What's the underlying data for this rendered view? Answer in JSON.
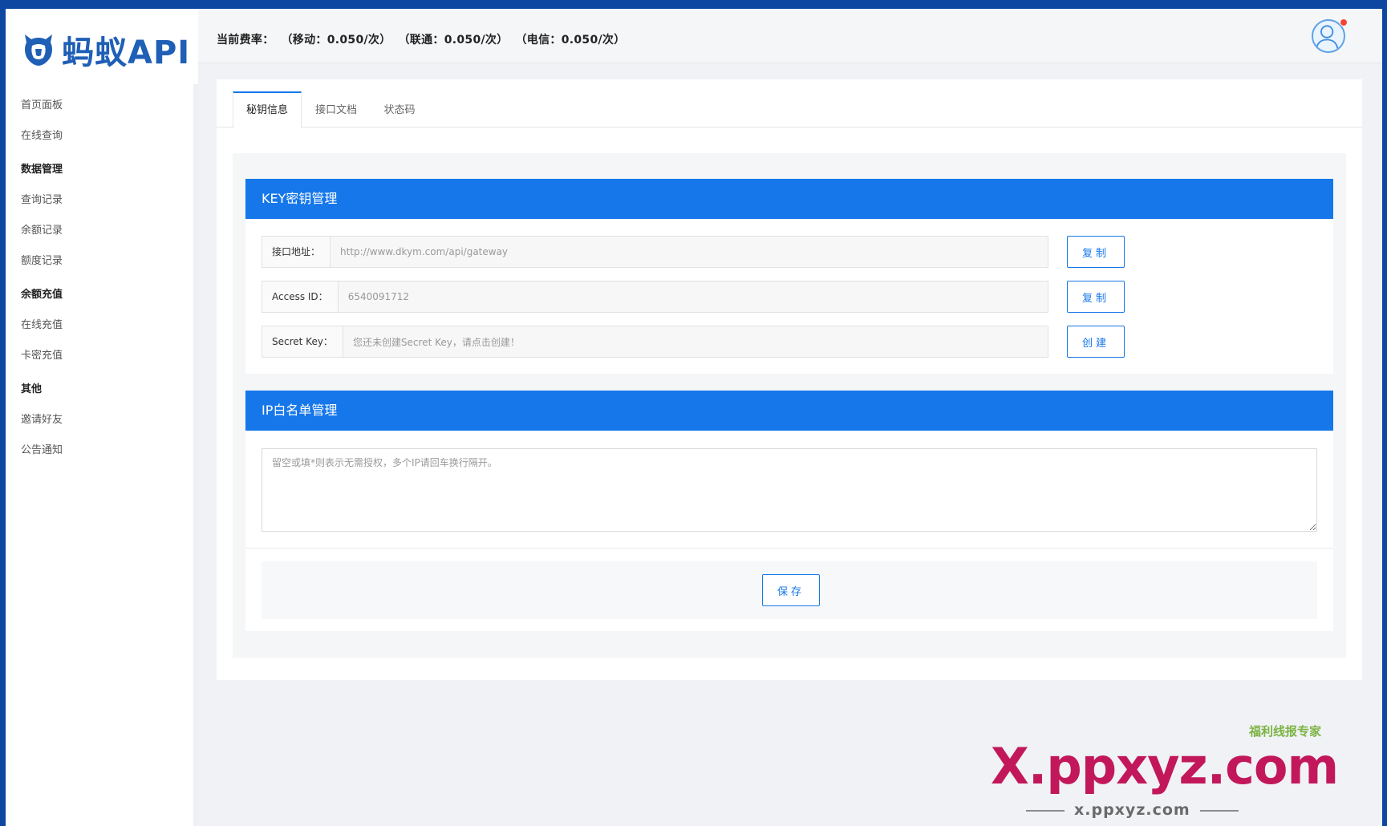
{
  "brand": {
    "name": "蚂蚁API",
    "color": "#1f5fb6"
  },
  "sidebar": {
    "items": [
      {
        "type": "item",
        "label": "首页面板"
      },
      {
        "type": "item",
        "label": "在线查询"
      },
      {
        "type": "group",
        "label": "数据管理"
      },
      {
        "type": "item",
        "label": "查询记录"
      },
      {
        "type": "item",
        "label": "余额记录"
      },
      {
        "type": "item",
        "label": "额度记录"
      },
      {
        "type": "group",
        "label": "余额充值"
      },
      {
        "type": "item",
        "label": "在线充值"
      },
      {
        "type": "item",
        "label": "卡密充值"
      },
      {
        "type": "group",
        "label": "其他"
      },
      {
        "type": "item",
        "label": "邀请好友"
      },
      {
        "type": "item",
        "label": "公告通知"
      }
    ]
  },
  "header": {
    "rate_label": "当前费率：",
    "rates": [
      "（移动：0.050/次）",
      "（联通：0.050/次）",
      "（电信：0.050/次）"
    ]
  },
  "tabs": [
    {
      "label": "秘钥信息",
      "active": true
    },
    {
      "label": "接口文档",
      "active": false
    },
    {
      "label": "状态码",
      "active": false
    }
  ],
  "key_panel": {
    "title": "KEY密钥管理",
    "fields": [
      {
        "label": "接口地址：",
        "value": "http://www.dkym.com/api/gateway",
        "button": "复制"
      },
      {
        "label": "Access ID：",
        "value": "6540091712",
        "button": "复制"
      },
      {
        "label": "Secret Key：",
        "value": "您还未创建Secret Key，请点击创建！",
        "button": "创建"
      }
    ]
  },
  "ip_panel": {
    "title": "IP白名单管理",
    "placeholder": "留空或填*则表示无需授权，多个IP请回车换行隔开。",
    "save_label": "保存"
  },
  "watermark": {
    "tag": "福利线报专家",
    "main": "X.ppxyz.com",
    "sub": "x.ppxyz.com"
  },
  "colors": {
    "primary": "#1677ea",
    "outer": "#0d47a1",
    "badge": "#f44336"
  }
}
